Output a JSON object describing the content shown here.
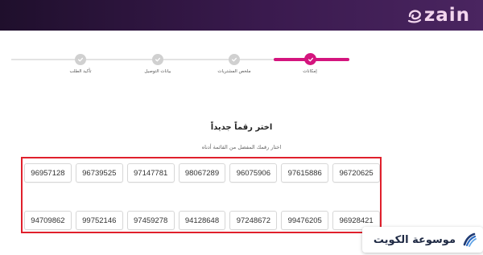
{
  "brand": {
    "logo_text": "zain",
    "logo_icon": "zain-swirl-icon"
  },
  "stepper": {
    "steps": [
      {
        "label": "تأكيد الطلب",
        "state": "done"
      },
      {
        "label": "بيانات التوصيل",
        "state": "done"
      },
      {
        "label": "ملخص المشتريات",
        "state": "done"
      },
      {
        "label": "إمكانات",
        "state": "active"
      }
    ],
    "colors": {
      "active": "#d4157e",
      "inactive": "#d0d0d0"
    }
  },
  "section": {
    "title": "اختر رقماً جديداً",
    "subtitle": "اختار رقمك المفضل من القائمة أدناه"
  },
  "numbers": {
    "row1": [
      "96957128",
      "96739525",
      "97147781",
      "98067289",
      "96075906",
      "97615886",
      "96720625"
    ],
    "row2": [
      "94709862",
      "99752146",
      "97459278",
      "94128648",
      "97248672",
      "99476205",
      "96928421"
    ]
  },
  "highlight_color": "#e0202c",
  "watermark": {
    "text": "موسوعة الكويت",
    "icon": "kuwait-encyclopedia-logo"
  }
}
